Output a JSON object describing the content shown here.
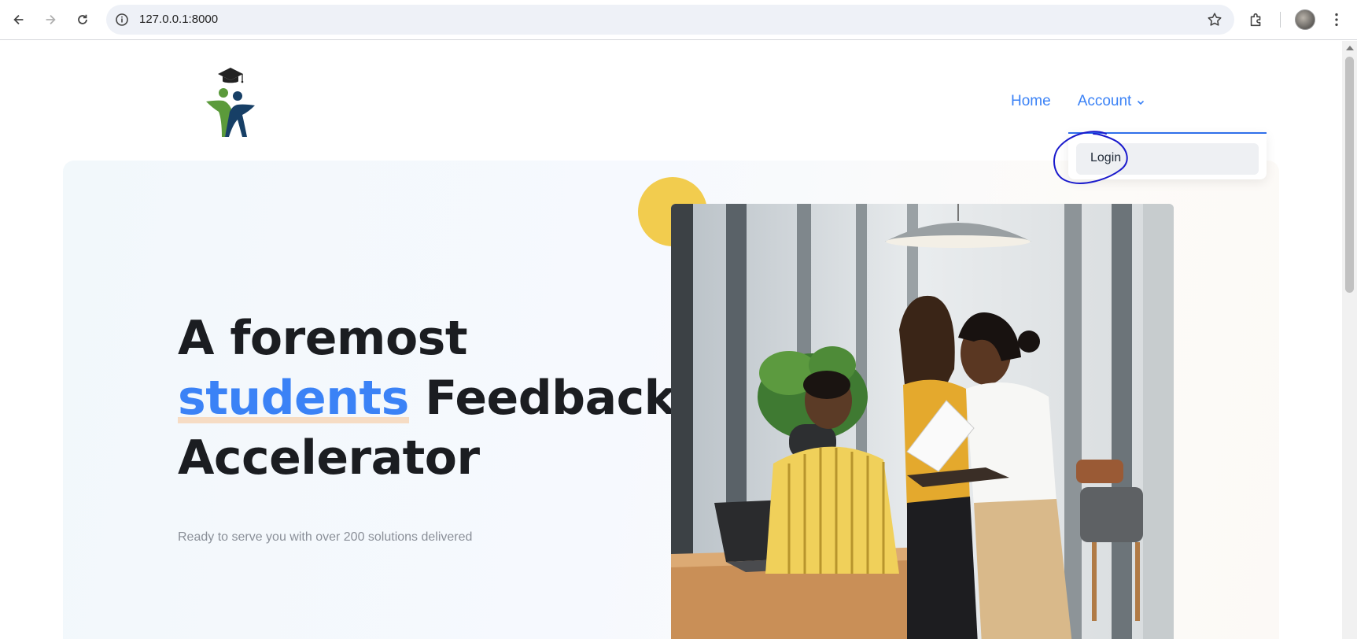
{
  "browser": {
    "url": "127.0.0.1:8000",
    "icons": [
      "back-icon",
      "forward-icon",
      "reload-icon",
      "site-info-icon",
      "bookmark-star-icon",
      "extensions-icon",
      "profile-avatar",
      "more-menu-icon"
    ]
  },
  "nav": {
    "home": "Home",
    "account": "Account",
    "dropdown_login": "Login"
  },
  "hero": {
    "title_line1": "A foremost",
    "title_highlight": "students",
    "title_line2_rest": " Feedback",
    "title_line3": "Accelerator",
    "subtitle": "Ready to serve you with over 200 solutions delivered"
  },
  "colors": {
    "accent": "#3b82f6",
    "heading": "#1b1d21",
    "yellow": "#f2cc4e",
    "annotation": "#1a1acc"
  }
}
